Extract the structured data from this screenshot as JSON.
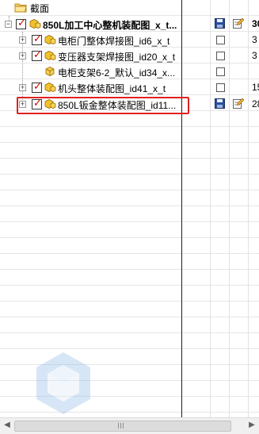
{
  "tree": {
    "root": {
      "label": "截面"
    },
    "assembly": {
      "label": "850L加工中心整机装配图_x_t...",
      "value": "30"
    },
    "children": [
      {
        "label": "电柜门整体焊接图_id6_x_t",
        "value": "3"
      },
      {
        "label": "变压器支架焊接图_id20_x_t",
        "value": "3"
      },
      {
        "label": "电柜支架6-2_默认_id34_x...",
        "value": ""
      },
      {
        "label": "机头整体装配图_id41_x_t",
        "value": "15"
      },
      {
        "label": "850L钣金整体装配图_id11...",
        "value": "28"
      }
    ]
  },
  "colors": {
    "check_mark": "#d40000",
    "highlight_border": "#e02020",
    "box_yellow": "#f2c12e",
    "grid_line": "#e6e6e6"
  },
  "icons": {
    "folder": "folder-icon",
    "part": "part-cube-icon",
    "save": "floppy-disk-icon",
    "edit": "edit-note-icon",
    "watermark": "cube-logo-watermark"
  },
  "scrollbar": {
    "left_arrow": "◀",
    "right_arrow": "▶"
  }
}
